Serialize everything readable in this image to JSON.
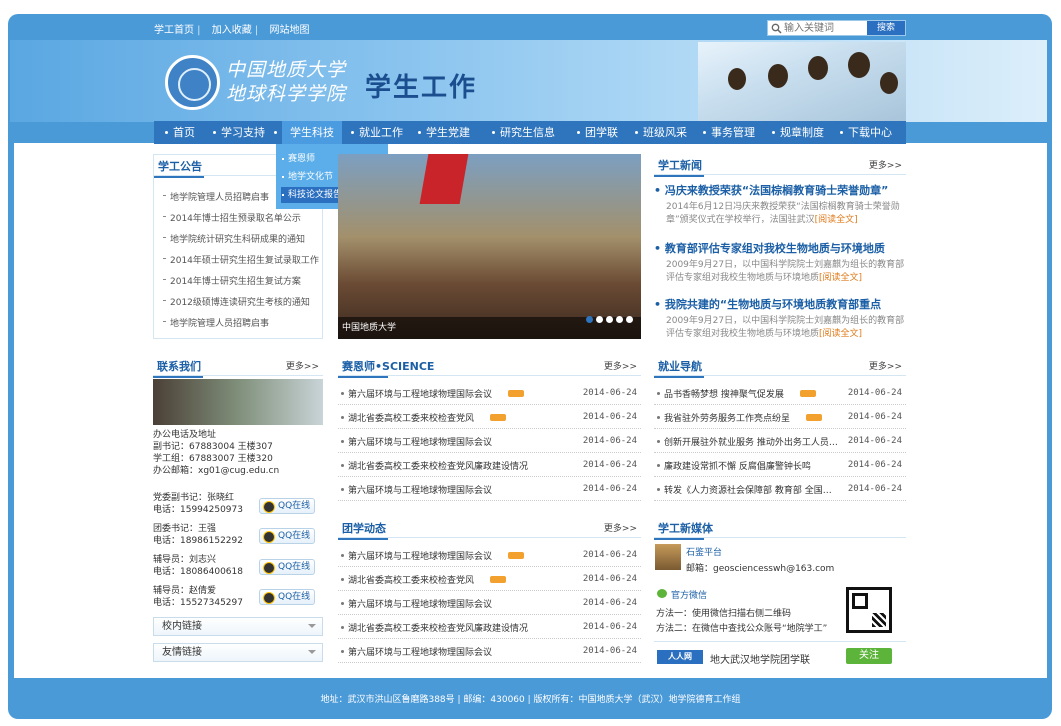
{
  "top_links": [
    "学工首页",
    "加入收藏",
    "网站地图"
  ],
  "search": {
    "placeholder": "输入关键词",
    "button": "搜索"
  },
  "header": {
    "university_line1": "中国地质大学",
    "university_line2": "地球科学学院",
    "title": "学生工作"
  },
  "nav": {
    "items": [
      "首页",
      "学习支持",
      "学生科技",
      "就业工作",
      "学生党建",
      "研究生信息",
      "团学联",
      "班级风采",
      "事务管理",
      "规章制度",
      "下载中心"
    ],
    "active": "学生科技"
  },
  "dropdown": [
    "赛恩师",
    "地学文化节",
    "科技论文报告会成果展"
  ],
  "notice": {
    "title": "学工公告",
    "items": [
      "地学院管理人员招聘启事",
      "2014年博士招生预录取名单公示",
      "地学院统计研究生科研成果的通知",
      "2014年硕士研究生招生复试录取工作",
      "2014年博士研究生招生复试方案",
      "2012级硕博连读研究生考核的通知",
      "地学院管理人员招聘启事"
    ]
  },
  "slide": {
    "caption": "中国地质大学"
  },
  "news": {
    "title": "学工新闻",
    "more": "更多>>",
    "items": [
      {
        "headline": "冯庆来教授荣获“法国棕榈教育骑士荣誉勋章”",
        "desc": "2014年6月12日冯庆来教授荣获“法国棕榈教育骑士荣誉勋章”颁奖仪式在学校举行，法国驻武汉",
        "read": "[阅读全文]"
      },
      {
        "headline": "教育部评估专家组对我校生物地质与环境地质",
        "desc": "2009年9月27日，以中国科学院院士刘嘉麒为组长的教育部评估专家组对我校生物地质与环境地质",
        "read": "[阅读全文]"
      },
      {
        "headline": "我院共建的“生物地质与环境地质教育部重点",
        "desc": "2009年9月27日，以中国科学院院士刘嘉麒为组长的教育部评估专家组对我校生物地质与环境地质",
        "read": "[阅读全文]"
      }
    ]
  },
  "contact": {
    "title": "联系我们",
    "more": "更多>>",
    "office_title": "办公电话及地址",
    "lines": [
      "副书记：67883004    王楼307",
      "学工组：67883007    王楼320",
      "办公邮箱：xg01@cug.edu.cn"
    ],
    "people": [
      {
        "role": "党委副书记：张晓红",
        "phone": "电话：15994250973"
      },
      {
        "role": "团委书记：王强",
        "phone": "电话：18986152292"
      },
      {
        "role": "辅导员：刘志兴",
        "phone": "电话：18086400618"
      },
      {
        "role": "辅导员：赵倩爱",
        "phone": "电话：15527345297"
      }
    ],
    "qq_label": "QQ在线"
  },
  "links": [
    "校内链接",
    "友情链接"
  ],
  "science": {
    "title": "赛恩师•SCIENCE",
    "more": "更多>>",
    "items": [
      {
        "text": "第六届环境与工程地球物理国际会议",
        "date": "2014-06-24",
        "new": true
      },
      {
        "text": "湖北省委高校工委来校检查党风",
        "date": "2014-06-24",
        "new": true
      },
      {
        "text": "第六届环境与工程地球物理国际会议",
        "date": "2014-06-24",
        "new": false
      },
      {
        "text": "湖北省委高校工委来校检查党风廉政建设情况",
        "date": "2014-06-24",
        "new": false
      },
      {
        "text": "第六届环境与工程地球物理国际会议",
        "date": "2014-06-24",
        "new": false
      }
    ]
  },
  "league": {
    "title": "团学动态",
    "more": "更多>>",
    "items": [
      {
        "text": "第六届环境与工程地球物理国际会议",
        "date": "2014-06-24",
        "new": true
      },
      {
        "text": "湖北省委高校工委来校检查党风",
        "date": "2014-06-24",
        "new": true
      },
      {
        "text": "第六届环境与工程地球物理国际会议",
        "date": "2014-06-24",
        "new": false
      },
      {
        "text": "湖北省委高校工委来校检查党风廉政建设情况",
        "date": "2014-06-24",
        "new": false
      },
      {
        "text": "第六届环境与工程地球物理国际会议",
        "date": "2014-06-24",
        "new": false
      }
    ]
  },
  "career": {
    "title": "就业导航",
    "more": "更多>>",
    "items": [
      {
        "text": "品书香畅梦想  搜神聚气促发展",
        "date": "2014-06-24",
        "new": true
      },
      {
        "text": "我省驻外劳务服务工作亮点纷呈",
        "date": "2014-06-24",
        "new": true
      },
      {
        "text": "创新开展驻外就业服务  推动外出务工人员…",
        "date": "2014-06-24",
        "new": false
      },
      {
        "text": "廉政建设常抓不懈  反腐倡廉警钟长鸣",
        "date": "2014-06-24",
        "new": false
      },
      {
        "text": "转发《人力资源社会保障部  教育部  全国…",
        "date": "2014-06-24",
        "new": false
      }
    ]
  },
  "media": {
    "title": "学工新媒体",
    "weibo_name": "石鉴平台",
    "weibo_email": "邮箱：geosciencesswh@163.com",
    "wechat_title": "官方微信",
    "wechat_m1": "方法一：使用微信扫描右侧二维码",
    "wechat_m2": "方法二：在微信中查找公众账号“地院学工”",
    "renren_logo": "人人网",
    "renren_name": "地大武汉地学院团学联",
    "follow": "关注"
  },
  "footer": "地址：武汉市洪山区鲁磨路388号  |  邮编：430060  |  版权所有：中国地质大学（武汉）地学院德育工作组"
}
